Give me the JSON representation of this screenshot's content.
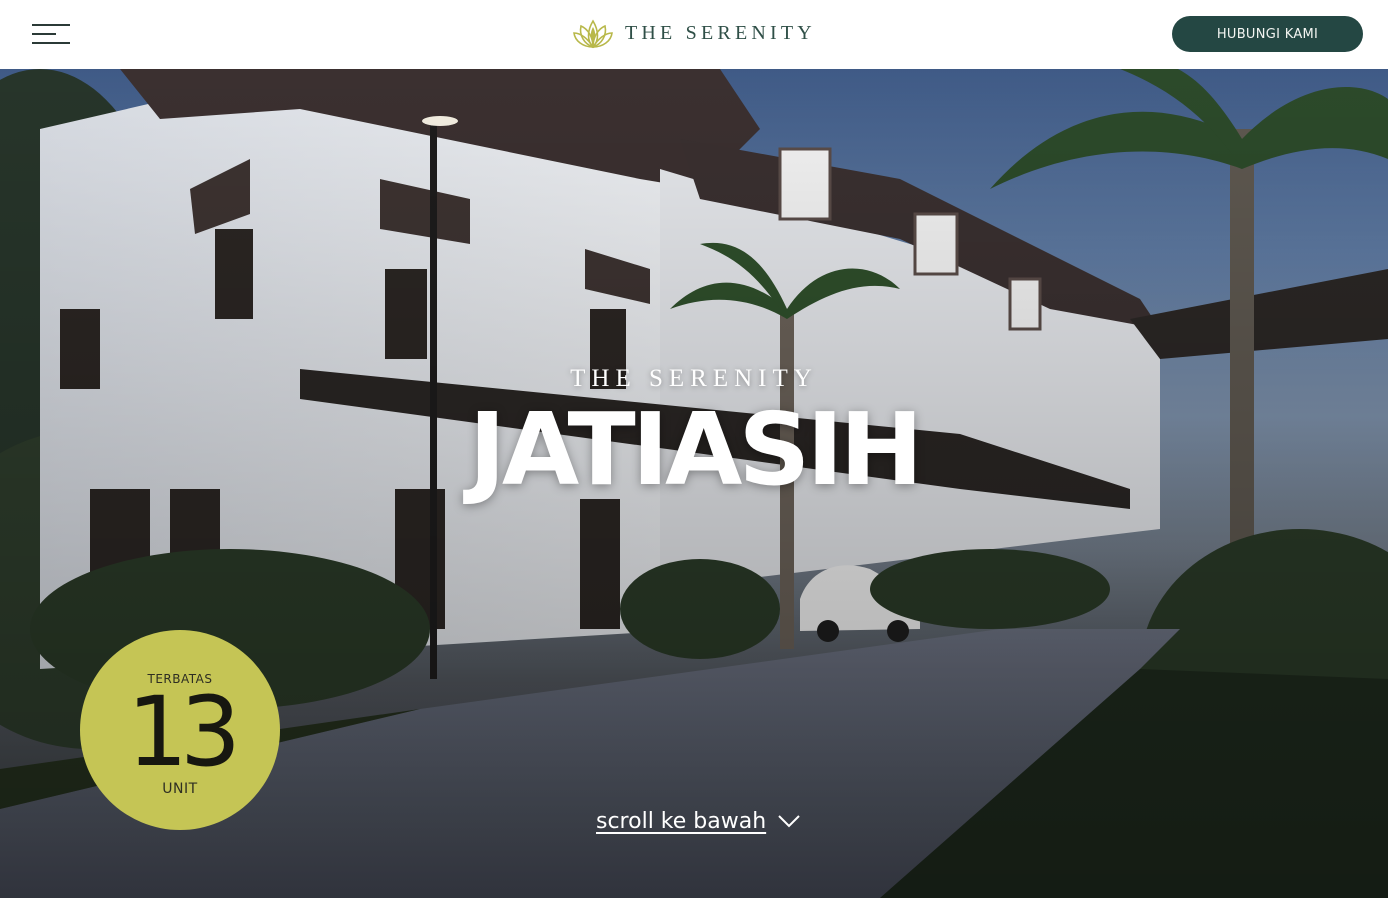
{
  "header": {
    "brand_name": "THE SERENITY",
    "logo_icon": "lotus-logo-icon",
    "menu_icon": "hamburger-menu-icon",
    "contact_button_label": "HUBUNGI KAMI"
  },
  "hero": {
    "eyebrow": "THE SERENITY",
    "title": "JATIASIH",
    "badge": {
      "top_text": "TERBATAS",
      "number": "13",
      "bottom_text": "UNIT"
    },
    "scroll_label": "scroll ke bawah",
    "scroll_icon": "chevron-down-icon"
  },
  "colors": {
    "brand_green": "#2f4f47",
    "button_bg": "#244743",
    "badge_bg": "#c5c555",
    "logo_gold": "#b8b84a"
  }
}
